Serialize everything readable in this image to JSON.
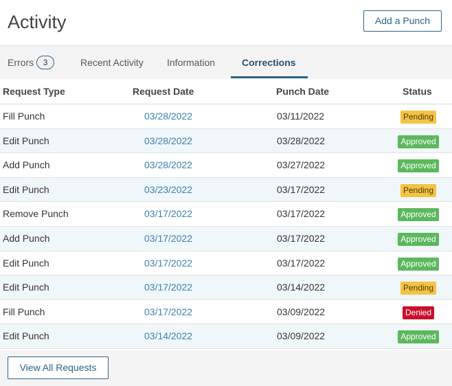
{
  "header": {
    "title": "Activity",
    "add_punch_label": "Add a Punch"
  },
  "tabs": [
    {
      "label": "Errors",
      "count": "3"
    },
    {
      "label": "Recent Activity"
    },
    {
      "label": "Information"
    },
    {
      "label": "Corrections",
      "active": true
    }
  ],
  "table": {
    "columns": [
      "Request Type",
      "Request Date",
      "Punch Date",
      "Status"
    ],
    "rows": [
      {
        "type": "Fill Punch",
        "request_date": "03/28/2022",
        "punch_date": "03/11/2022",
        "status": "Pending"
      },
      {
        "type": "Edit Punch",
        "request_date": "03/28/2022",
        "punch_date": "03/28/2022",
        "status": "Approved"
      },
      {
        "type": "Add Punch",
        "request_date": "03/28/2022",
        "punch_date": "03/27/2022",
        "status": "Approved"
      },
      {
        "type": "Edit Punch",
        "request_date": "03/23/2022",
        "punch_date": "03/17/2022",
        "status": "Pending"
      },
      {
        "type": "Remove Punch",
        "request_date": "03/17/2022",
        "punch_date": "03/17/2022",
        "status": "Approved"
      },
      {
        "type": "Add Punch",
        "request_date": "03/17/2022",
        "punch_date": "03/17/2022",
        "status": "Approved"
      },
      {
        "type": "Edit Punch",
        "request_date": "03/17/2022",
        "punch_date": "03/17/2022",
        "status": "Approved"
      },
      {
        "type": "Edit Punch",
        "request_date": "03/17/2022",
        "punch_date": "03/14/2022",
        "status": "Pending"
      },
      {
        "type": "Fill Punch",
        "request_date": "03/17/2022",
        "punch_date": "03/09/2022",
        "status": "Denied"
      },
      {
        "type": "Edit Punch",
        "request_date": "03/14/2022",
        "punch_date": "03/09/2022",
        "status": "Approved"
      }
    ]
  },
  "footer": {
    "view_all_label": "View All Requests"
  },
  "colors": {
    "accent": "#2b6385",
    "link": "#3a7fb0",
    "pending": "#f5c343",
    "approved": "#5cb85c",
    "denied": "#c8102e"
  }
}
